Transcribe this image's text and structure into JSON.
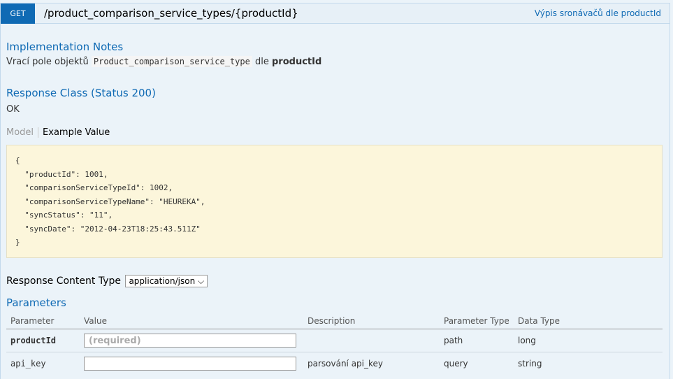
{
  "operation": {
    "method": "GET",
    "path": "/product_comparison_service_types/{productId}",
    "summary": "Výpis sronávačů dle productId",
    "method_color": "#0f6ab4"
  },
  "implementation_notes": {
    "title": "Implementation Notes",
    "text_before": "Vrací pole objektů",
    "code": "Product_comparison_service_type",
    "text_middle": "dle",
    "bold": "productId"
  },
  "response_class": {
    "title": "Response Class (Status 200)",
    "status_text": "OK"
  },
  "tabs": {
    "model": "Model",
    "example": "Example Value"
  },
  "example_json": "{\n  \"productId\": 1001,\n  \"comparisonServiceTypeId\": 1002,\n  \"comparisonServiceTypeName\": \"HEUREKA\",\n  \"syncStatus\": \"11\",\n  \"syncDate\": \"2012-04-23T18:25:43.511Z\"\n}",
  "response_content_type": {
    "label": "Response Content Type",
    "selected": "application/json"
  },
  "parameters": {
    "title": "Parameters",
    "headers": [
      "Parameter",
      "Value",
      "Description",
      "Parameter Type",
      "Data Type"
    ],
    "rows": [
      {
        "name": "productId",
        "value": "",
        "placeholder": "(required)",
        "description": "",
        "param_type": "path",
        "data_type": "long"
      },
      {
        "name": "api_key",
        "value": "",
        "placeholder": "",
        "description": "parsování api_key",
        "param_type": "query",
        "data_type": "string"
      }
    ]
  }
}
